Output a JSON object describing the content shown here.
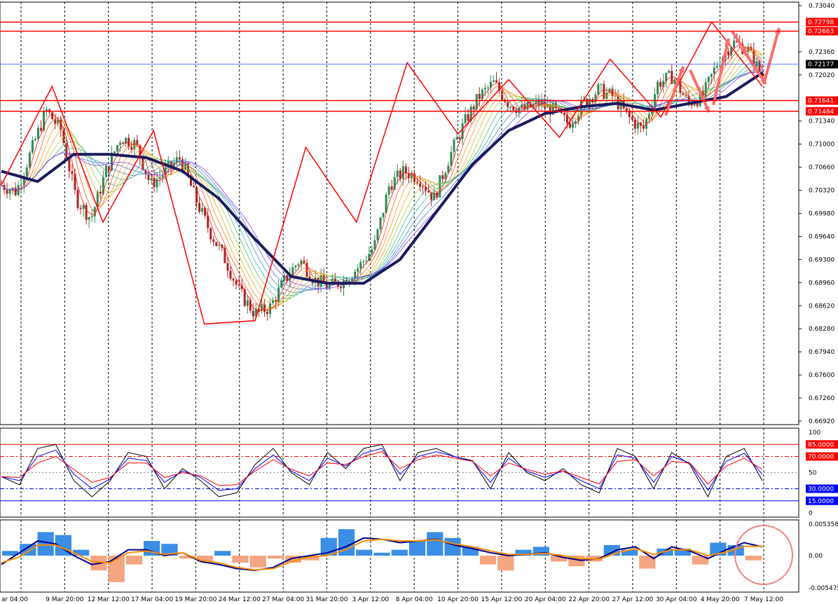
{
  "chart_data": [
    {
      "panel": "price",
      "type": "candlestick",
      "title": "",
      "ylim": [
        0.6692,
        0.7304
      ],
      "y_ticks": [
        "0.73040",
        "0.72360",
        "0.72020",
        "0.71340",
        "0.71000",
        "0.70660",
        "0.70320",
        "0.69980",
        "0.69640",
        "0.69300",
        "0.68960",
        "0.68620",
        "0.68280",
        "0.67940",
        "0.67600",
        "0.67260",
        "0.66920"
      ],
      "x_ticks": [
        "ar 04:00",
        "9 Mar 20:00",
        "12 Mar 12:00",
        "17 Mar 04:00",
        "19 Mar 20:00",
        "24 Mar 12:00",
        "27 Mar 04:00",
        "31 Mar 20:00",
        "3 Apr 12:00",
        "8 Apr 04:00",
        "10 Apr 20:00",
        "15 Apr 12:00",
        "20 Apr 04:00",
        "22 Apr 20:00",
        "27 Apr 12:00",
        "30 Apr 04:00",
        "4 May 20:00",
        "7 May 12:00"
      ],
      "price_levels": [
        {
          "label": "0.72798",
          "value": 0.72798,
          "color": "#ff0000"
        },
        {
          "label": "0.72663",
          "value": 0.72663,
          "color": "#ff0000"
        },
        {
          "label": "0.72177",
          "value": 0.72177,
          "color": "#000000"
        },
        {
          "label": "0.71641",
          "value": 0.71641,
          "color": "#ff0000"
        },
        {
          "label": "0.71484",
          "value": 0.71484,
          "color": "#ff0000"
        }
      ],
      "zigzag_points": [
        0.704,
        0.7185,
        0.6985,
        0.712,
        0.6835,
        0.684,
        0.7095,
        0.6985,
        0.722,
        0.7115,
        0.7195,
        0.711,
        0.7225,
        0.714,
        0.728,
        0.7185
      ],
      "ma_slow": [
        0.706,
        0.7045,
        0.7085,
        0.7085,
        0.708,
        0.706,
        0.702,
        0.696,
        0.6905,
        0.6895,
        0.6895,
        0.693,
        0.7,
        0.707,
        0.712,
        0.7145,
        0.7155,
        0.716,
        0.715,
        0.716,
        0.717,
        0.7205
      ],
      "colors": {
        "up_candle": "#2e8b57",
        "down_candle": "#b22222",
        "zigzag": "#ff0000",
        "ma_slow": "#1a1a5e",
        "price_line": "#3355ff"
      }
    },
    {
      "panel": "stochastic",
      "type": "line",
      "ylim": [
        0,
        100
      ],
      "y_ticks": [
        "100",
        "50",
        "0"
      ],
      "levels": [
        {
          "label": "85.0000",
          "value": 85,
          "color": "#ff0000"
        },
        {
          "label": "70.0000",
          "value": 70,
          "color": "#ff0000"
        },
        {
          "label": "30.0000",
          "value": 30,
          "color": "#0000ff"
        },
        {
          "label": "15.0000",
          "value": 15,
          "color": "#0000ff"
        }
      ],
      "series": [
        {
          "color": "#000000",
          "values": [
            45,
            35,
            80,
            85,
            40,
            20,
            40,
            75,
            70,
            30,
            55,
            40,
            20,
            25,
            60,
            80,
            50,
            35,
            75,
            55,
            80,
            85,
            40,
            75,
            80,
            70,
            65,
            30,
            75,
            50,
            40,
            55,
            35,
            25,
            80,
            70,
            30,
            75,
            60,
            20,
            70,
            80,
            40
          ]
        },
        {
          "color": "#0000ff",
          "values": [
            45,
            40,
            70,
            78,
            48,
            30,
            42,
            68,
            65,
            38,
            52,
            44,
            28,
            30,
            55,
            72,
            52,
            40,
            68,
            58,
            74,
            80,
            48,
            70,
            76,
            70,
            64,
            38,
            68,
            52,
            44,
            52,
            40,
            30,
            72,
            68,
            38,
            70,
            62,
            28,
            64,
            74,
            48
          ]
        },
        {
          "color": "#ff0000",
          "values": [
            45,
            44,
            62,
            70,
            54,
            38,
            44,
            62,
            62,
            44,
            50,
            46,
            34,
            35,
            52,
            66,
            54,
            46,
            62,
            60,
            70,
            76,
            55,
            66,
            72,
            68,
            64,
            46,
            62,
            54,
            48,
            52,
            44,
            36,
            64,
            66,
            46,
            64,
            62,
            36,
            58,
            68,
            54
          ]
        }
      ]
    },
    {
      "panel": "macd",
      "type": "bar",
      "ylim": [
        -0.005475,
        0.005358
      ],
      "y_ticks": [
        "0.005358",
        "0.00",
        "-0.005475"
      ],
      "histogram": [
        0.0008,
        0.002,
        0.004,
        0.0035,
        0.001,
        -0.0025,
        -0.0045,
        -0.0015,
        0.0025,
        0.002,
        -0.0005,
        -0.001,
        0.0008,
        -0.0012,
        -0.002,
        -0.0005,
        -0.0012,
        -0.0008,
        0.003,
        0.0045,
        0.001,
        0.0005,
        0.001,
        0.0025,
        0.004,
        0.003,
        0.0015,
        -0.0015,
        -0.0025,
        0.001,
        0.0015,
        -0.001,
        -0.0018,
        -0.001,
        0.0018,
        0.001,
        -0.0022,
        0.0012,
        0.0012,
        -0.0015,
        0.0022,
        0.0018,
        -0.0008
      ],
      "series": [
        {
          "color": "#00008b",
          "values": [
            -0.0015,
            0.0005,
            0.0025,
            0.002,
            0.0,
            -0.0015,
            -0.001,
            0.001,
            0.001,
            0.0,
            0.0005,
            -0.001,
            -0.0015,
            -0.0022,
            -0.0025,
            -0.002,
            -0.0005,
            0.0,
            0.0005,
            0.0015,
            0.003,
            0.0028,
            0.0022,
            0.0025,
            0.0028,
            0.0018,
            0.0012,
            0.0005,
            0.0,
            0.0002,
            0.0005,
            -0.0003,
            -0.0008,
            -0.0005,
            0.001,
            0.0015,
            -0.0005,
            0.0015,
            0.0008,
            -0.0005,
            0.001,
            0.0022,
            0.0015
          ]
        },
        {
          "color": "#ff8c00",
          "values": [
            -0.0012,
            -0.0002,
            0.0018,
            0.0018,
            0.0005,
            -0.001,
            -0.0012,
            0.0005,
            0.0008,
            0.0002,
            0.0005,
            -0.0008,
            -0.0012,
            -0.002,
            -0.0024,
            -0.0022,
            -0.001,
            -0.0002,
            0.0,
            0.001,
            0.0025,
            0.0028,
            0.0025,
            0.0025,
            0.0027,
            0.002,
            0.0015,
            0.0008,
            0.0002,
            0.0002,
            0.0004,
            0.0,
            -0.0005,
            -0.0006,
            0.0005,
            0.0012,
            0.0002,
            0.001,
            0.001,
            0.0,
            0.0006,
            0.0016,
            0.0016
          ]
        }
      ]
    }
  ]
}
